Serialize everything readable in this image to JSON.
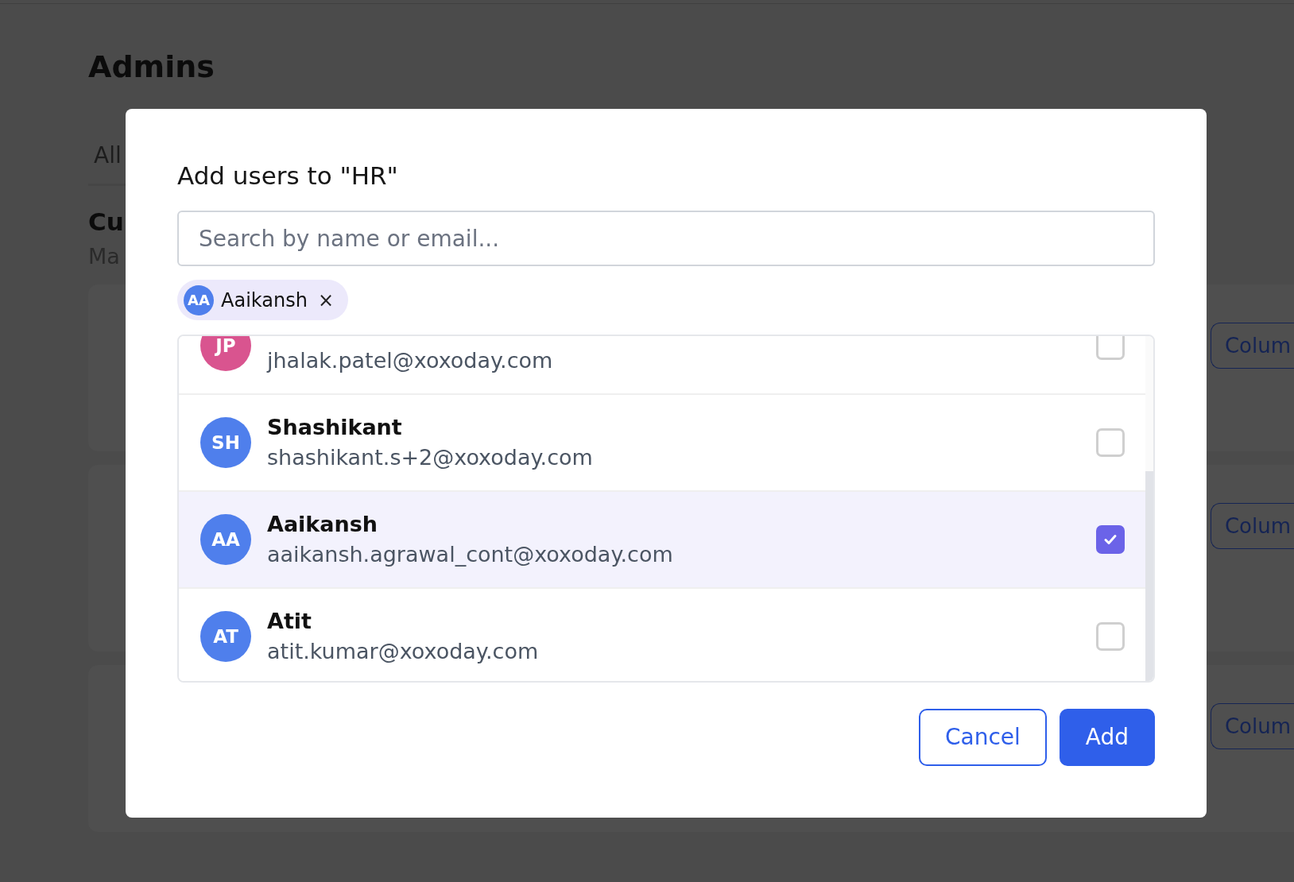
{
  "page": {
    "title": "Admins",
    "tab": "All",
    "section_title": "Cu",
    "section_subtitle": "Ma",
    "cards": [
      {
        "button": "Colum"
      },
      {
        "button": "Colum"
      },
      {
        "button": "Colum"
      }
    ]
  },
  "dialog": {
    "title": "Add users to \"HR\"",
    "search": {
      "placeholder": "Search by name or email..."
    },
    "chips": [
      {
        "initials": "AA",
        "label": "Aaikansh",
        "remove": "×",
        "color": "#4f7fec"
      }
    ],
    "users": [
      {
        "initials": "JP",
        "email": "jhalak.patel@xoxoday.com",
        "checked": false,
        "color": "#d9548f"
      },
      {
        "initials": "SH",
        "name": "Shashikant",
        "email": "shashikant.s+2@xoxoday.com",
        "checked": false,
        "color": "#4f7fec"
      },
      {
        "initials": "AA",
        "name": "Aaikansh",
        "email": "aaikansh.agrawal_cont@xoxoday.com",
        "checked": true,
        "color": "#4f7fec"
      },
      {
        "initials": "AT",
        "name": "Atit",
        "email": "atit.kumar@xoxoday.com",
        "checked": false,
        "color": "#4f7fec"
      }
    ],
    "buttons": [
      {
        "label": "Cancel",
        "kind": "secondary"
      },
      {
        "label": "Add",
        "kind": "primary"
      }
    ]
  }
}
